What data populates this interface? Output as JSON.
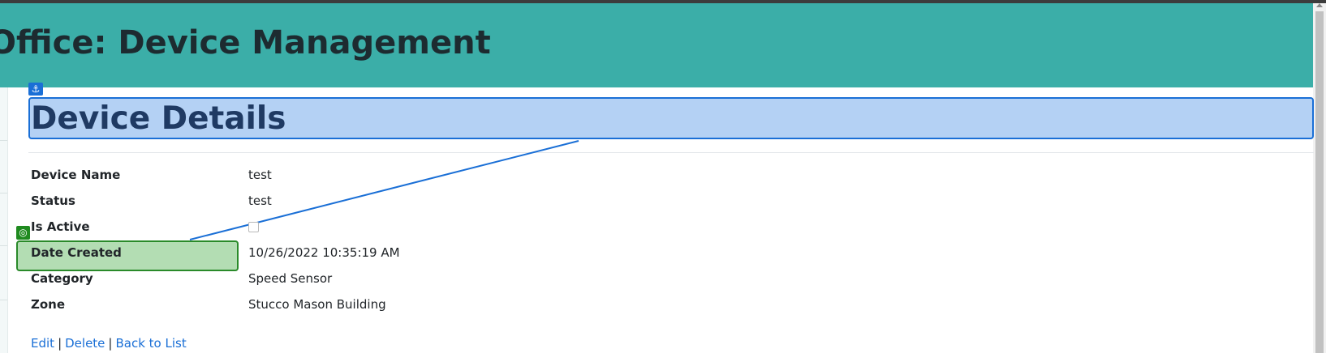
{
  "banner": {
    "title": "Office: Device Management"
  },
  "annotations": {
    "anchor_icon": "anchor-icon",
    "target_icon": "target-icon",
    "accent": "#1a6fd6",
    "target_color": "#1f8a1f"
  },
  "page": {
    "heading": "Device Details"
  },
  "details": {
    "device_name": {
      "label": "Device Name",
      "value": "test"
    },
    "status": {
      "label": "Status",
      "value": "test"
    },
    "is_active": {
      "label": "Is Active",
      "checked": false
    },
    "date_created": {
      "label": "Date Created",
      "value": "10/26/2022 10:35:19 AM"
    },
    "category": {
      "label": "Category",
      "value": "Speed Sensor"
    },
    "zone": {
      "label": "Zone",
      "value": "Stucco Mason Building"
    }
  },
  "actions": {
    "edit": "Edit",
    "delete": "Delete",
    "back": "Back to List",
    "separator": "|"
  },
  "colors": {
    "banner": "#3baea8",
    "heading_highlight": "#b4d1f4",
    "target_highlight": "#b3ddb3"
  }
}
